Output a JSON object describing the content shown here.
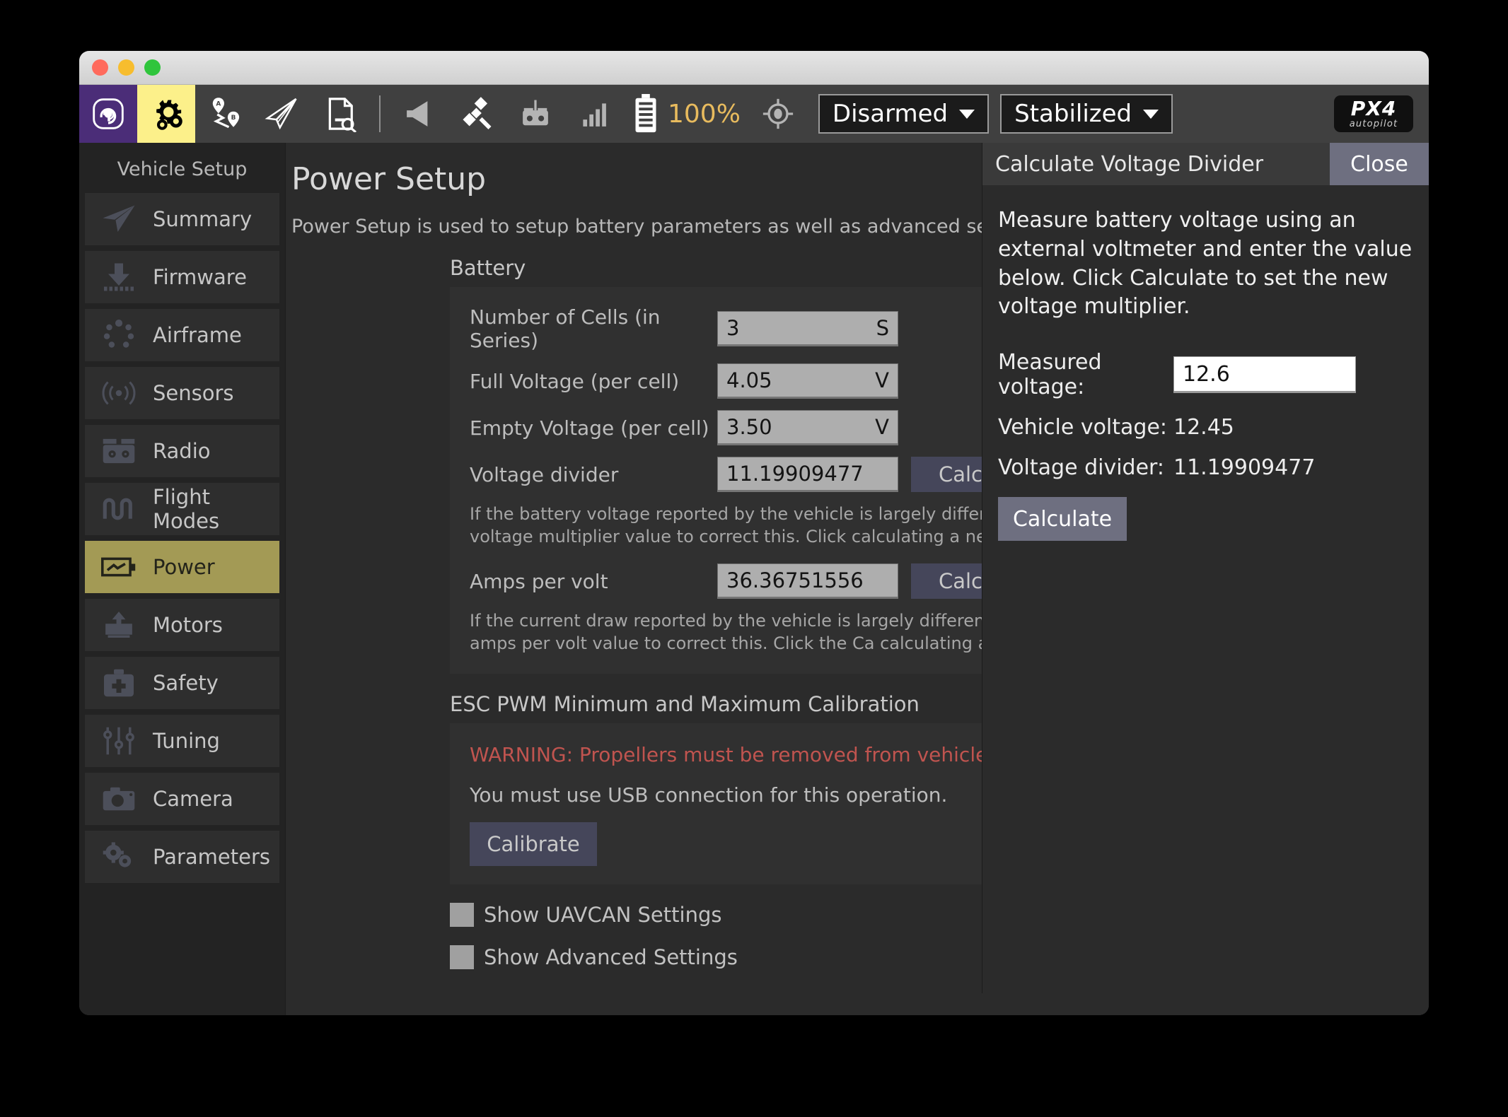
{
  "window": {
    "traffic_lights": [
      "close",
      "minimize",
      "zoom"
    ]
  },
  "toolbar": {
    "icons": [
      {
        "name": "qgc-logo-icon",
        "glyph": "Q"
      },
      {
        "name": "gears-icon",
        "glyph": "gears"
      },
      {
        "name": "plan-waypoints-icon",
        "glyph": "A-B"
      },
      {
        "name": "fly-view-icon",
        "glyph": "paper-plane"
      },
      {
        "name": "analyze-icon",
        "glyph": "document-search"
      },
      {
        "name": "message-indicator-icon",
        "glyph": "megaphone"
      },
      {
        "name": "gps-indicator-icon",
        "glyph": "satellite"
      },
      {
        "name": "rc-indicator-icon",
        "glyph": "remote-control"
      },
      {
        "name": "telemetry-signal-icon",
        "glyph": "signal-bars"
      },
      {
        "name": "battery-indicator-icon",
        "glyph": "battery"
      }
    ],
    "battery_percent": "100%",
    "armed_state": "Disarmed",
    "flight_mode": "Stabilized",
    "px4_logo_line1": "PX4",
    "px4_logo_line2": "autopilot"
  },
  "sidebar": {
    "title": "Vehicle Setup",
    "items": [
      {
        "label": "Summary",
        "icon": "paper-plane-icon",
        "selected": false
      },
      {
        "label": "Firmware",
        "icon": "download-chip-icon",
        "selected": false
      },
      {
        "label": "Airframe",
        "icon": "airframe-dots-icon",
        "selected": false
      },
      {
        "label": "Sensors",
        "icon": "sensor-waves-icon",
        "selected": false
      },
      {
        "label": "Radio",
        "icon": "radio-controller-icon",
        "selected": false
      },
      {
        "label": "Flight Modes",
        "icon": "flight-modes-icon",
        "selected": false
      },
      {
        "label": "Power",
        "icon": "battery-bolt-icon",
        "selected": true
      },
      {
        "label": "Motors",
        "icon": "motor-icon",
        "selected": false
      },
      {
        "label": "Safety",
        "icon": "first-aid-kit-icon",
        "selected": false
      },
      {
        "label": "Tuning",
        "icon": "sliders-icon",
        "selected": false
      },
      {
        "label": "Camera",
        "icon": "camera-icon",
        "selected": false
      },
      {
        "label": "Parameters",
        "icon": "gears-icon",
        "selected": false
      }
    ]
  },
  "main": {
    "title": "Power Setup",
    "description": "Power Setup is used to setup battery parameters as well as advanced settings",
    "battery_section_heading": "Battery",
    "fields": {
      "cells_label": "Number of Cells (in Series)",
      "cells_value": "3",
      "cells_unit": "S",
      "full_voltage_label": "Full Voltage (per cell)",
      "full_voltage_value": "4.05",
      "full_voltage_unit": "V",
      "empty_voltage_label": "Empty Voltage (per cell)",
      "empty_voltage_value": "3.50",
      "empty_voltage_unit": "V",
      "voltage_divider_label": "Voltage divider",
      "voltage_divider_value": "11.19909477",
      "voltage_divider_button": "Calc",
      "voltage_divider_help": "If the battery voltage reported by the vehicle is largely different than the voltmeter you can adjust the voltage multiplier value to correct this. Click calculating a new value.",
      "amps_per_volt_label": "Amps per volt",
      "amps_per_volt_value": "36.36751556",
      "amps_per_volt_button": "Calc",
      "amps_per_volt_help": "If the current draw reported by the vehicle is largely different than the current meter you can adjust the amps per volt value to correct this. Click the Ca calculating a new value."
    },
    "esc_section_heading": "ESC PWM Minimum and Maximum Calibration",
    "esc_warning": "WARNING: Propellers must be removed from vehicle prior to calibration.",
    "esc_usb_note": "You must use USB connection for this operation.",
    "esc_calibrate_button": "Calibrate",
    "checkboxes": [
      {
        "label": "Show UAVCAN Settings",
        "checked": false
      },
      {
        "label": "Show Advanced Settings",
        "checked": false
      }
    ]
  },
  "dialog": {
    "title": "Calculate Voltage Divider",
    "close_label": "Close",
    "intro": "Measure battery voltage using an external voltmeter and enter the value below. Click Calculate to set the new voltage multiplier.",
    "measured_voltage_label": "Measured voltage:",
    "measured_voltage_value": "12.6",
    "vehicle_voltage_label": "Vehicle voltage:",
    "vehicle_voltage_value": "12.45",
    "voltage_divider_label": "Voltage divider:",
    "voltage_divider_value": "11.19909477",
    "calculate_button": "Calculate"
  },
  "colors": {
    "accent_selected": "#a39a55",
    "toolbar_bg": "#404040",
    "qgc_purple": "#4b2d78",
    "gear_yellow": "#fcf08a",
    "warning_red": "#c0544f",
    "battery_amber": "#e8bb5e",
    "button_slate": "#45465a",
    "dialog_close": "#6e6f80"
  }
}
